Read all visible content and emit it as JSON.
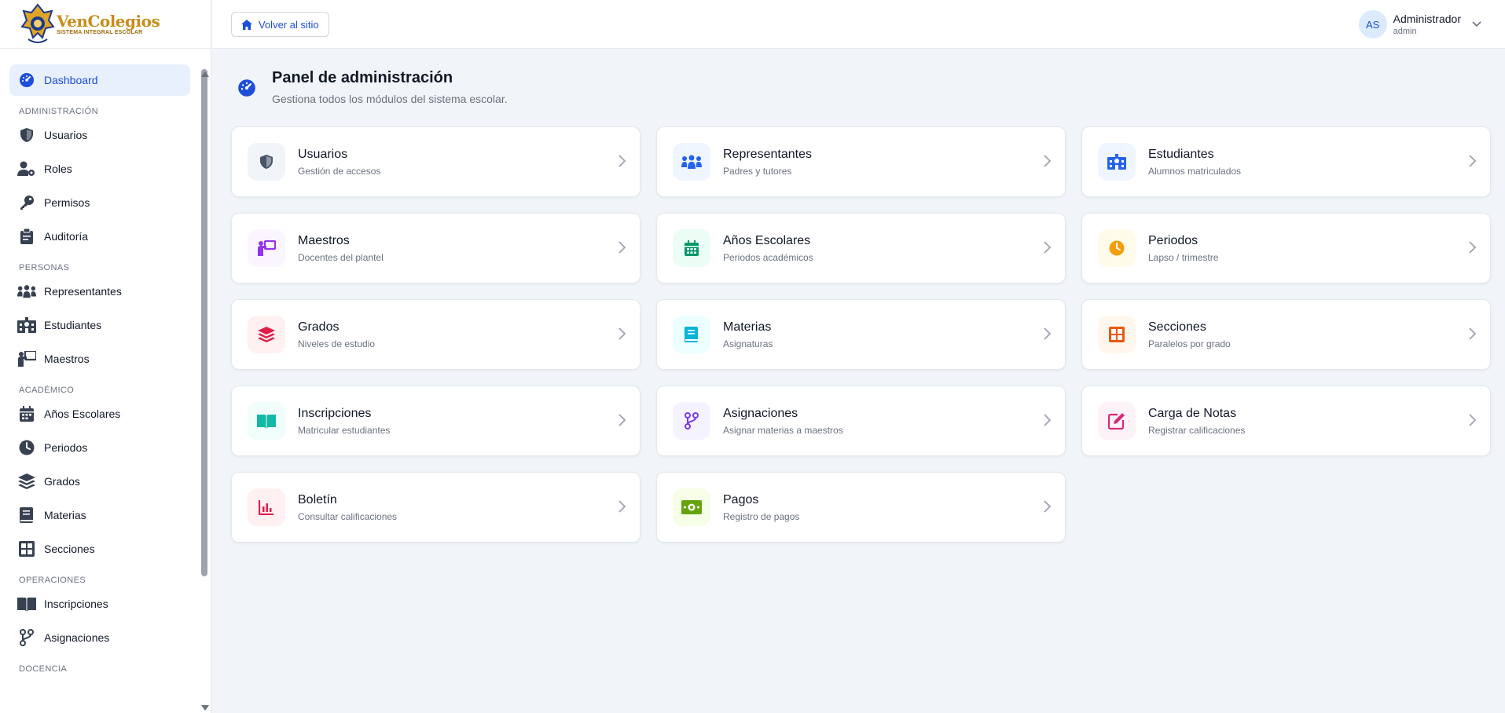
{
  "brand": {
    "name": "VenColegios",
    "tagline": "SISTEMA INTEGRAL ESCOLAR"
  },
  "sidebar": {
    "dashboard": "Dashboard",
    "sections": [
      {
        "title": "ADMINISTRACIÓN",
        "items": [
          "Usuarios",
          "Roles",
          "Permisos",
          "Auditoría"
        ]
      },
      {
        "title": "PERSONAS",
        "items": [
          "Representantes",
          "Estudiantes",
          "Maestros"
        ]
      },
      {
        "title": "ACADÉMICO",
        "items": [
          "Años Escolares",
          "Periodos",
          "Grados",
          "Materias",
          "Secciones"
        ]
      },
      {
        "title": "OPERACIONES",
        "items": [
          "Inscripciones",
          "Asignaciones"
        ]
      },
      {
        "title": "DOCENCIA",
        "items": []
      }
    ]
  },
  "topbar": {
    "back_label": "Volver al sitio",
    "user_initials": "AS",
    "user_name": "Administrador",
    "user_role": "admin"
  },
  "page": {
    "title": "Panel de administración",
    "subtitle": "Gestiona todos los módulos del sistema escolar."
  },
  "cards": [
    {
      "title": "Usuarios",
      "subtitle": "Gestión de accesos",
      "icon": "shield-icon",
      "color": "#475569",
      "bg": "#f1f5f9"
    },
    {
      "title": "Representantes",
      "subtitle": "Padres y tutores",
      "icon": "people-group-icon",
      "color": "#2563eb",
      "bg": "#eff6ff"
    },
    {
      "title": "Estudiantes",
      "subtitle": "Alumnos matriculados",
      "icon": "school-building-icon",
      "color": "#2563eb",
      "bg": "#eff6ff"
    },
    {
      "title": "Maestros",
      "subtitle": "Docentes del plantel",
      "icon": "teacher-board-icon",
      "color": "#9333ea",
      "bg": "#faf5ff"
    },
    {
      "title": "Años Escolares",
      "subtitle": "Periodos académicos",
      "icon": "calendar-icon",
      "color": "#059669",
      "bg": "#ecfdf5"
    },
    {
      "title": "Periodos",
      "subtitle": "Lapso / trimestre",
      "icon": "clock-icon",
      "color": "#f59e0b",
      "bg": "#fffbeb"
    },
    {
      "title": "Grados",
      "subtitle": "Niveles de estudio",
      "icon": "layers-icon",
      "color": "#e11d48",
      "bg": "#fff1f2"
    },
    {
      "title": "Materias",
      "subtitle": "Asignaturas",
      "icon": "book-icon",
      "color": "#06b6d4",
      "bg": "#ecfeff"
    },
    {
      "title": "Secciones",
      "subtitle": "Paralelos por grado",
      "icon": "grid-table-icon",
      "color": "#ea580c",
      "bg": "#fff7ed"
    },
    {
      "title": "Inscripciones",
      "subtitle": "Matricular estudiantes",
      "icon": "open-book-icon",
      "color": "#14b8a6",
      "bg": "#f0fdfa"
    },
    {
      "title": "Asignaciones",
      "subtitle": "Asignar materias a maestros",
      "icon": "code-branch-icon",
      "color": "#7c3aed",
      "bg": "#f5f3ff"
    },
    {
      "title": "Carga de Notas",
      "subtitle": "Registrar calificaciones",
      "icon": "pen-square-icon",
      "color": "#db2777",
      "bg": "#fdf2f8"
    },
    {
      "title": "Boletín",
      "subtitle": "Consultar calificaciones",
      "icon": "bar-chart-icon",
      "color": "#e11d48",
      "bg": "#fff1f2"
    },
    {
      "title": "Pagos",
      "subtitle": "Registro de pagos",
      "icon": "money-bill-icon",
      "color": "#65a30d",
      "bg": "#f7fee7"
    }
  ]
}
